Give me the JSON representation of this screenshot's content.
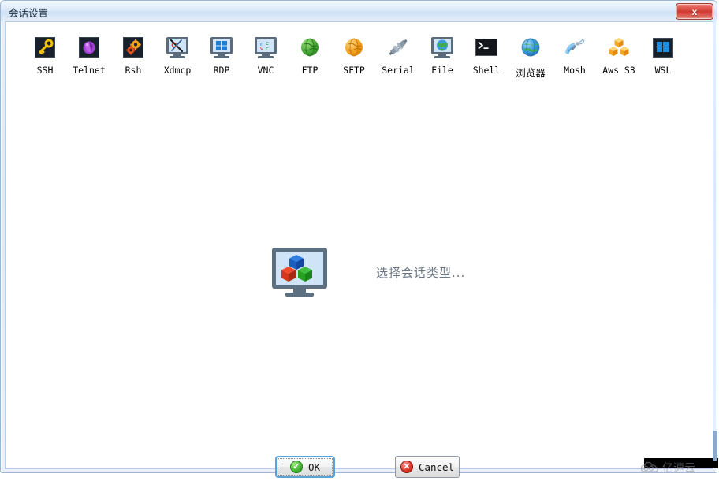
{
  "window": {
    "title": "会话设置",
    "close_label": "x",
    "close_icon": "close-icon"
  },
  "toolbar": {
    "items": [
      {
        "label": "SSH",
        "icon": "ssh-key-icon"
      },
      {
        "label": "Telnet",
        "icon": "telnet-crystal-icon"
      },
      {
        "label": "Rsh",
        "icon": "rsh-gears-icon"
      },
      {
        "label": "Xdmcp",
        "icon": "xdmcp-monitor-x-icon"
      },
      {
        "label": "RDP",
        "icon": "rdp-monitor-windows-icon"
      },
      {
        "label": "VNC",
        "icon": "vnc-monitor-icon"
      },
      {
        "label": "FTP",
        "icon": "ftp-green-globe-icon"
      },
      {
        "label": "SFTP",
        "icon": "sftp-orange-globe-icon"
      },
      {
        "label": "Serial",
        "icon": "serial-plug-icon"
      },
      {
        "label": "File",
        "icon": "file-monitor-globe-icon"
      },
      {
        "label": "Shell",
        "icon": "shell-terminal-icon"
      },
      {
        "label": "浏览器",
        "icon": "browser-globe-icon"
      },
      {
        "label": "Mosh",
        "icon": "mosh-satellite-icon"
      },
      {
        "label": "Aws S3",
        "icon": "aws-s3-cubes-icon"
      },
      {
        "label": "WSL",
        "icon": "wsl-windows-icon"
      }
    ]
  },
  "main": {
    "placeholder_text": "选择会话类型...",
    "placeholder_icon": "monitor-cubes-icon"
  },
  "footer": {
    "ok_label": "OK",
    "ok_icon": "check-circle-icon",
    "cancel_label": "Cancel",
    "cancel_icon": "x-circle-icon"
  },
  "watermark": {
    "text": "亿速云",
    "icon": "cloud-logo-icon"
  },
  "colors": {
    "titlebar_accent": "#cfe1f5",
    "close_red": "#cf3a31",
    "ok_green": "#49b833",
    "cancel_red": "#e0392c",
    "focus_blue": "#5aa2d8",
    "frame_border": "#9cb6d4"
  }
}
